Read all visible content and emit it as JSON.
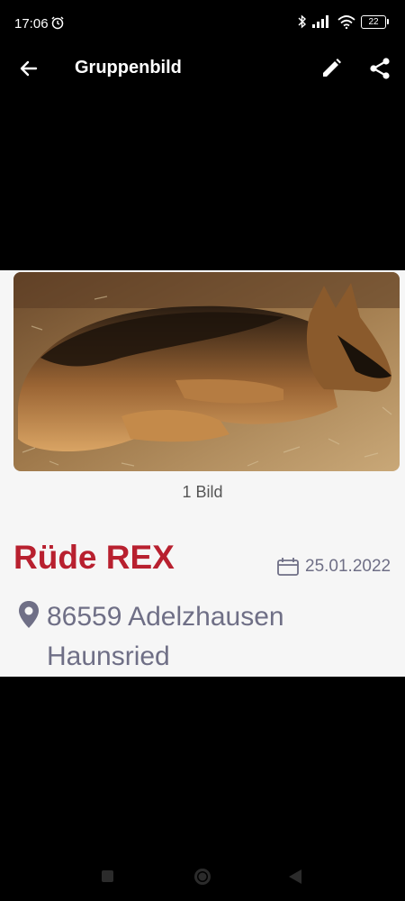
{
  "status": {
    "time": "17:06",
    "battery": "22"
  },
  "appbar": {
    "title": "Gruppenbild"
  },
  "card": {
    "image_count": "1 Bild",
    "name": "Rüde REX",
    "date": "25.01.2022",
    "address_line1": "86559 Adelzhausen",
    "address_line2": "Haunsried"
  },
  "colors": {
    "name_accent": "#b8202f",
    "meta_text": "#6f6f86",
    "card_bg": "#f6f6f6"
  }
}
